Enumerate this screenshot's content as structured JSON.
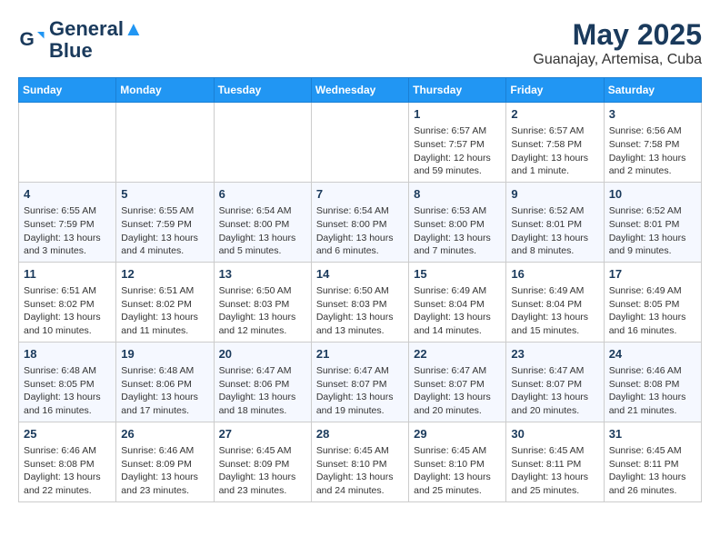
{
  "header": {
    "logo_line1": "General",
    "logo_line2": "Blue",
    "title": "May 2025",
    "subtitle": "Guanajay, Artemisa, Cuba"
  },
  "weekdays": [
    "Sunday",
    "Monday",
    "Tuesday",
    "Wednesday",
    "Thursday",
    "Friday",
    "Saturday"
  ],
  "weeks": [
    [
      {
        "day": "",
        "content": ""
      },
      {
        "day": "",
        "content": ""
      },
      {
        "day": "",
        "content": ""
      },
      {
        "day": "",
        "content": ""
      },
      {
        "day": "1",
        "content": "Sunrise: 6:57 AM\nSunset: 7:57 PM\nDaylight: 12 hours\nand 59 minutes."
      },
      {
        "day": "2",
        "content": "Sunrise: 6:57 AM\nSunset: 7:58 PM\nDaylight: 13 hours\nand 1 minute."
      },
      {
        "day": "3",
        "content": "Sunrise: 6:56 AM\nSunset: 7:58 PM\nDaylight: 13 hours\nand 2 minutes."
      }
    ],
    [
      {
        "day": "4",
        "content": "Sunrise: 6:55 AM\nSunset: 7:59 PM\nDaylight: 13 hours\nand 3 minutes."
      },
      {
        "day": "5",
        "content": "Sunrise: 6:55 AM\nSunset: 7:59 PM\nDaylight: 13 hours\nand 4 minutes."
      },
      {
        "day": "6",
        "content": "Sunrise: 6:54 AM\nSunset: 8:00 PM\nDaylight: 13 hours\nand 5 minutes."
      },
      {
        "day": "7",
        "content": "Sunrise: 6:54 AM\nSunset: 8:00 PM\nDaylight: 13 hours\nand 6 minutes."
      },
      {
        "day": "8",
        "content": "Sunrise: 6:53 AM\nSunset: 8:00 PM\nDaylight: 13 hours\nand 7 minutes."
      },
      {
        "day": "9",
        "content": "Sunrise: 6:52 AM\nSunset: 8:01 PM\nDaylight: 13 hours\nand 8 minutes."
      },
      {
        "day": "10",
        "content": "Sunrise: 6:52 AM\nSunset: 8:01 PM\nDaylight: 13 hours\nand 9 minutes."
      }
    ],
    [
      {
        "day": "11",
        "content": "Sunrise: 6:51 AM\nSunset: 8:02 PM\nDaylight: 13 hours\nand 10 minutes."
      },
      {
        "day": "12",
        "content": "Sunrise: 6:51 AM\nSunset: 8:02 PM\nDaylight: 13 hours\nand 11 minutes."
      },
      {
        "day": "13",
        "content": "Sunrise: 6:50 AM\nSunset: 8:03 PM\nDaylight: 13 hours\nand 12 minutes."
      },
      {
        "day": "14",
        "content": "Sunrise: 6:50 AM\nSunset: 8:03 PM\nDaylight: 13 hours\nand 13 minutes."
      },
      {
        "day": "15",
        "content": "Sunrise: 6:49 AM\nSunset: 8:04 PM\nDaylight: 13 hours\nand 14 minutes."
      },
      {
        "day": "16",
        "content": "Sunrise: 6:49 AM\nSunset: 8:04 PM\nDaylight: 13 hours\nand 15 minutes."
      },
      {
        "day": "17",
        "content": "Sunrise: 6:49 AM\nSunset: 8:05 PM\nDaylight: 13 hours\nand 16 minutes."
      }
    ],
    [
      {
        "day": "18",
        "content": "Sunrise: 6:48 AM\nSunset: 8:05 PM\nDaylight: 13 hours\nand 16 minutes."
      },
      {
        "day": "19",
        "content": "Sunrise: 6:48 AM\nSunset: 8:06 PM\nDaylight: 13 hours\nand 17 minutes."
      },
      {
        "day": "20",
        "content": "Sunrise: 6:47 AM\nSunset: 8:06 PM\nDaylight: 13 hours\nand 18 minutes."
      },
      {
        "day": "21",
        "content": "Sunrise: 6:47 AM\nSunset: 8:07 PM\nDaylight: 13 hours\nand 19 minutes."
      },
      {
        "day": "22",
        "content": "Sunrise: 6:47 AM\nSunset: 8:07 PM\nDaylight: 13 hours\nand 20 minutes."
      },
      {
        "day": "23",
        "content": "Sunrise: 6:47 AM\nSunset: 8:07 PM\nDaylight: 13 hours\nand 20 minutes."
      },
      {
        "day": "24",
        "content": "Sunrise: 6:46 AM\nSunset: 8:08 PM\nDaylight: 13 hours\nand 21 minutes."
      }
    ],
    [
      {
        "day": "25",
        "content": "Sunrise: 6:46 AM\nSunset: 8:08 PM\nDaylight: 13 hours\nand 22 minutes."
      },
      {
        "day": "26",
        "content": "Sunrise: 6:46 AM\nSunset: 8:09 PM\nDaylight: 13 hours\nand 23 minutes."
      },
      {
        "day": "27",
        "content": "Sunrise: 6:45 AM\nSunset: 8:09 PM\nDaylight: 13 hours\nand 23 minutes."
      },
      {
        "day": "28",
        "content": "Sunrise: 6:45 AM\nSunset: 8:10 PM\nDaylight: 13 hours\nand 24 minutes."
      },
      {
        "day": "29",
        "content": "Sunrise: 6:45 AM\nSunset: 8:10 PM\nDaylight: 13 hours\nand 25 minutes."
      },
      {
        "day": "30",
        "content": "Sunrise: 6:45 AM\nSunset: 8:11 PM\nDaylight: 13 hours\nand 25 minutes."
      },
      {
        "day": "31",
        "content": "Sunrise: 6:45 AM\nSunset: 8:11 PM\nDaylight: 13 hours\nand 26 minutes."
      }
    ]
  ]
}
